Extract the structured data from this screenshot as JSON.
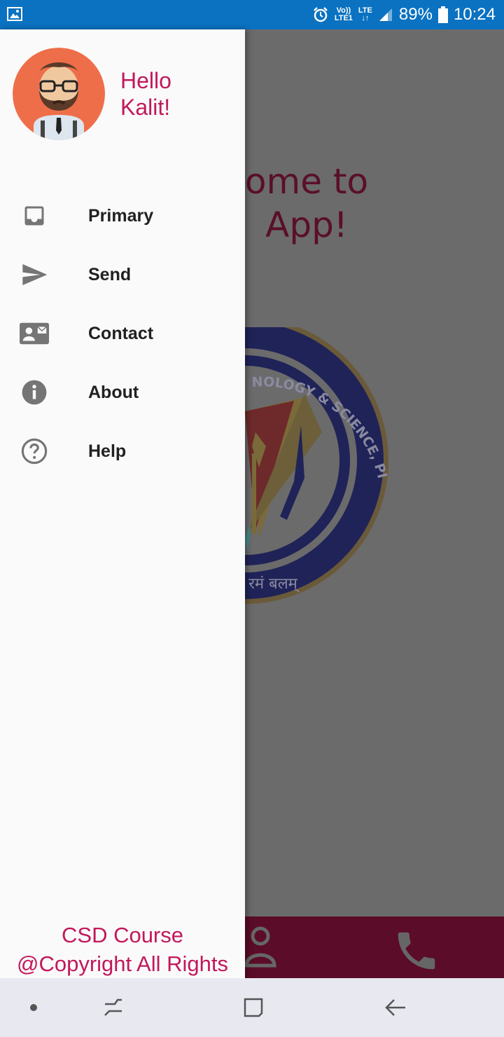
{
  "status_bar": {
    "battery": "89%",
    "time": "10:24",
    "volte": "Vo))",
    "lte1": "LTE1",
    "lte": "LTE"
  },
  "background": {
    "welcome_line1": "ome to",
    "welcome_line2": "App!",
    "logo_text": "NOLOGY & SCIENCE, PILANI",
    "logo_bottom_text": "रमं बलम्"
  },
  "drawer": {
    "greeting_line1": "Hello",
    "greeting_line2": "Kalit!",
    "items": [
      {
        "label": "Primary",
        "icon": "inbox-icon"
      },
      {
        "label": "Send",
        "icon": "send-icon"
      },
      {
        "label": "Contact",
        "icon": "contact-card-icon"
      },
      {
        "label": "About",
        "icon": "info-icon"
      },
      {
        "label": "Help",
        "icon": "help-icon"
      }
    ],
    "footer_line1": "CSD Course",
    "footer_line2": "@Copyright All Rights"
  },
  "colors": {
    "accent": "#c2185b",
    "status_bar": "#0a72c1",
    "bottom_bar": "#5a0c28"
  }
}
